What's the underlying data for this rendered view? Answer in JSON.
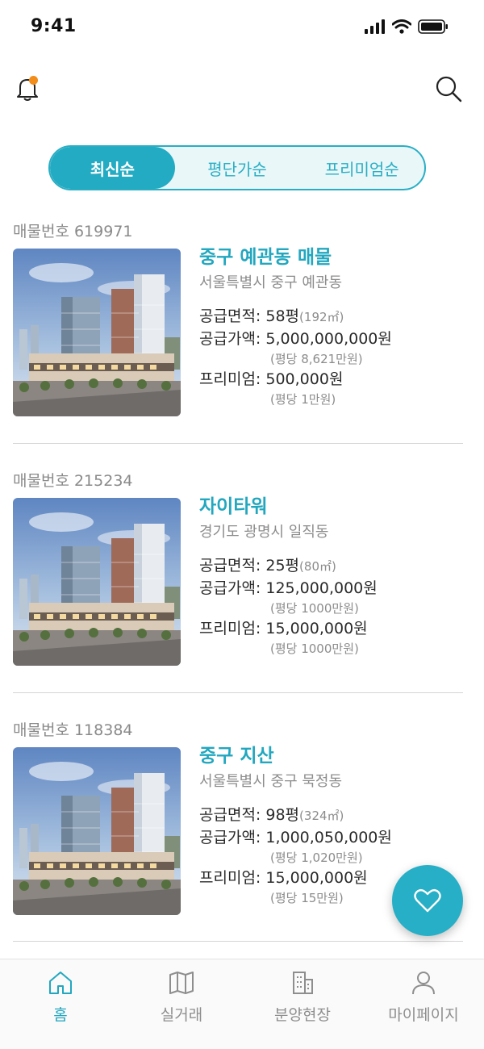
{
  "status_bar": {
    "time": "9:41"
  },
  "sort_tabs": [
    {
      "label": "최신순",
      "active": true
    },
    {
      "label": "평단가순",
      "active": false
    },
    {
      "label": "프리미엄순",
      "active": false
    }
  ],
  "listings": [
    {
      "id_label": "매물번호 619971",
      "title": "중구 예관동 매물",
      "address": "서울특별시 중구 예관동",
      "area_label": "공급면적: ",
      "area": "58평",
      "area_sub": "(192㎡)",
      "price_label": "공급가액: ",
      "price": "5,000,000,000원",
      "price_sub": "(평당 8,621만원)",
      "premium_label": "프리미엄: ",
      "premium": "500,000원",
      "premium_sub": "(평당 1만원)"
    },
    {
      "id_label": "매물번호 215234",
      "title": "자이타워",
      "address": "경기도 광명시 일직동",
      "area_label": "공급면적: ",
      "area": "25평",
      "area_sub": "(80㎡)",
      "price_label": "공급가액: ",
      "price": "125,000,000원",
      "price_sub": "(평당 1000만원)",
      "premium_label": "프리미엄: ",
      "premium": "15,000,000원",
      "premium_sub": "(평당 1000만원)"
    },
    {
      "id_label": "매물번호 118384",
      "title": "중구 지산",
      "address": "서울특별시 중구 묵정동",
      "area_label": "공급면적: ",
      "area": "98평",
      "area_sub": "(324㎡)",
      "price_label": "공급가액: ",
      "price": "1,000,050,000원",
      "price_sub": "(평당 1,020만원)",
      "premium_label": "프리미엄: ",
      "premium": "15,000,000원",
      "premium_sub": "(평당 15만원)"
    }
  ],
  "tab_bar": [
    {
      "label": "홈",
      "icon": "home-icon",
      "active": true
    },
    {
      "label": "실거래",
      "icon": "map-icon",
      "active": false
    },
    {
      "label": "분양현장",
      "icon": "building-icon",
      "active": false
    },
    {
      "label": "마이페이지",
      "icon": "person-icon",
      "active": false
    }
  ],
  "colors": {
    "accent": "#22abc2",
    "notification_dot": "#f28c1a"
  }
}
